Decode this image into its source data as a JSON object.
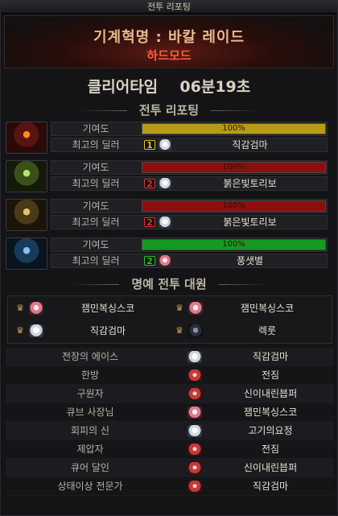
{
  "window": {
    "title": "전투 리포팅"
  },
  "banner": {
    "dungeon": "기계혁명 : 바칼 레이드",
    "mode": "하드모드"
  },
  "clear_time": {
    "label": "클리어타임",
    "value": "06분19초"
  },
  "battle_report": {
    "title": "전투 리포팅",
    "contribution_label": "기여도",
    "best_dealer_label": "최고의 딜러",
    "parties": [
      {
        "portrait_icon": "boss-red-icon",
        "contribution": "100%",
        "contribution_pct": 100,
        "bar_color": "#b89a16",
        "rank": "1",
        "rank_color": "#e2c419",
        "dealer": "직감검마"
      },
      {
        "portrait_icon": "boss-green-icon",
        "contribution": "100%",
        "contribution_pct": 100,
        "bar_color": "#8e0e0e",
        "rank": "2",
        "rank_color": "#e23030",
        "dealer": "붉은빛토리보"
      },
      {
        "portrait_icon": "boss-gold-icon",
        "contribution": "100%",
        "contribution_pct": 100,
        "bar_color": "#8e0e0e",
        "rank": "2",
        "rank_color": "#e23030",
        "dealer": "붉은빛토리보"
      },
      {
        "portrait_icon": "boss-blue-icon",
        "contribution": "100%",
        "contribution_pct": 100,
        "bar_color": "#149a20",
        "rank": "2",
        "rank_color": "#22c830",
        "dealer": "풍샛별"
      }
    ]
  },
  "honor": {
    "title": "명예 전투 대원",
    "members": [
      {
        "name": "잼민복싱스코"
      },
      {
        "name": "잼민복싱스코"
      },
      {
        "name": "직감검마"
      },
      {
        "name": "렉룻"
      }
    ]
  },
  "awards": [
    {
      "title": "전장의 에이스",
      "name": "직감검마"
    },
    {
      "title": "한방",
      "name": "전짐"
    },
    {
      "title": "구원자",
      "name": "신이내린븝퍼"
    },
    {
      "title": "큐브 사장님",
      "name": "잼민복싱스코"
    },
    {
      "title": "회피의 신",
      "name": "고기의요정"
    },
    {
      "title": "제압자",
      "name": "전짐"
    },
    {
      "title": "큐어 달인",
      "name": "신이내린븝퍼"
    },
    {
      "title": "상태이상 전문가",
      "name": "직감검마"
    }
  ]
}
